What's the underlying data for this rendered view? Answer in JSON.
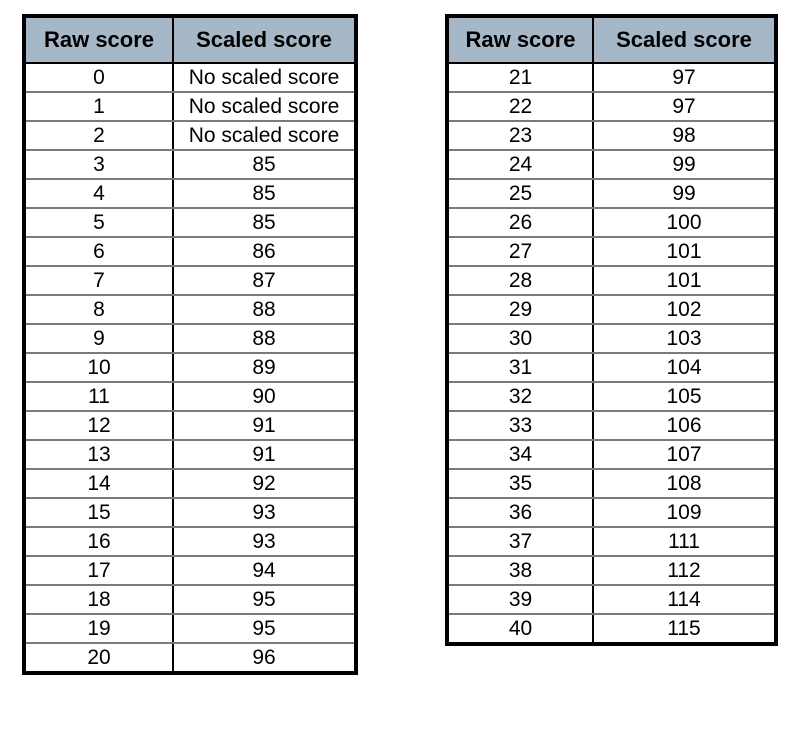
{
  "tables": [
    {
      "headers": {
        "raw": "Raw score",
        "scaled": "Scaled score"
      },
      "rows": [
        {
          "raw": "0",
          "scaled": "No scaled score"
        },
        {
          "raw": "1",
          "scaled": "No scaled score"
        },
        {
          "raw": "2",
          "scaled": "No scaled score"
        },
        {
          "raw": "3",
          "scaled": "85"
        },
        {
          "raw": "4",
          "scaled": "85"
        },
        {
          "raw": "5",
          "scaled": "85"
        },
        {
          "raw": "6",
          "scaled": "86"
        },
        {
          "raw": "7",
          "scaled": "87"
        },
        {
          "raw": "8",
          "scaled": "88"
        },
        {
          "raw": "9",
          "scaled": "88"
        },
        {
          "raw": "10",
          "scaled": "89"
        },
        {
          "raw": "11",
          "scaled": "90"
        },
        {
          "raw": "12",
          "scaled": "91"
        },
        {
          "raw": "13",
          "scaled": "91"
        },
        {
          "raw": "14",
          "scaled": "92"
        },
        {
          "raw": "15",
          "scaled": "93"
        },
        {
          "raw": "16",
          "scaled": "93"
        },
        {
          "raw": "17",
          "scaled": "94"
        },
        {
          "raw": "18",
          "scaled": "95"
        },
        {
          "raw": "19",
          "scaled": "95"
        },
        {
          "raw": "20",
          "scaled": "96"
        }
      ]
    },
    {
      "headers": {
        "raw": "Raw score",
        "scaled": "Scaled score"
      },
      "rows": [
        {
          "raw": "21",
          "scaled": "97"
        },
        {
          "raw": "22",
          "scaled": "97"
        },
        {
          "raw": "23",
          "scaled": "98"
        },
        {
          "raw": "24",
          "scaled": "99"
        },
        {
          "raw": "25",
          "scaled": "99"
        },
        {
          "raw": "26",
          "scaled": "100"
        },
        {
          "raw": "27",
          "scaled": "101"
        },
        {
          "raw": "28",
          "scaled": "101"
        },
        {
          "raw": "29",
          "scaled": "102"
        },
        {
          "raw": "30",
          "scaled": "103"
        },
        {
          "raw": "31",
          "scaled": "104"
        },
        {
          "raw": "32",
          "scaled": "105"
        },
        {
          "raw": "33",
          "scaled": "106"
        },
        {
          "raw": "34",
          "scaled": "107"
        },
        {
          "raw": "35",
          "scaled": "108"
        },
        {
          "raw": "36",
          "scaled": "109"
        },
        {
          "raw": "37",
          "scaled": "111"
        },
        {
          "raw": "38",
          "scaled": "112"
        },
        {
          "raw": "39",
          "scaled": "114"
        },
        {
          "raw": "40",
          "scaled": "115"
        }
      ]
    }
  ],
  "colors": {
    "header_bg": "#a6b8c8",
    "border": "#000000"
  }
}
